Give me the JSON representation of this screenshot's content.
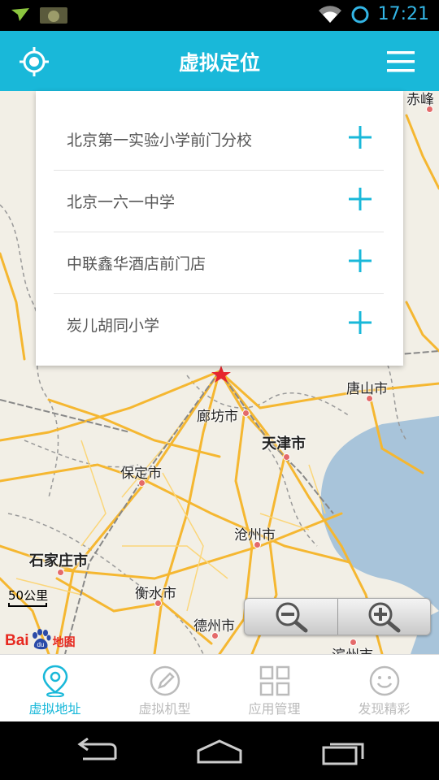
{
  "status_bar": {
    "time": "17:21"
  },
  "header": {
    "title": "虚拟定位"
  },
  "dropdown": {
    "items": [
      {
        "label": "北京第一实验小学前门分校"
      },
      {
        "label": "北京一六一中学"
      },
      {
        "label": "中联鑫华酒店前门店"
      },
      {
        "label": "炭儿胡同小学"
      }
    ]
  },
  "map": {
    "cities": {
      "chifeng": "赤峰",
      "langfang": "廊坊市",
      "tianjin": "天津市",
      "tangshan": "唐山市",
      "baoding": "保定市",
      "cangzhou": "沧州市",
      "shijiazhuang": "石家庄市",
      "hengshui": "衡水市",
      "dezhou": "德州市",
      "binzhou": "滨州市"
    },
    "scale_label": "50公里",
    "logo": {
      "bai": "Bai",
      "du": "du",
      "ditu": "地图"
    },
    "colors": {
      "land": "#f2efe6",
      "sea": "#a8c4da",
      "road": "#f5b731",
      "accent": "#19b8d9"
    }
  },
  "bottom_nav": {
    "items": [
      {
        "label": "虚拟地址"
      },
      {
        "label": "虚拟机型"
      },
      {
        "label": "应用管理"
      },
      {
        "label": "发现精彩"
      }
    ]
  }
}
